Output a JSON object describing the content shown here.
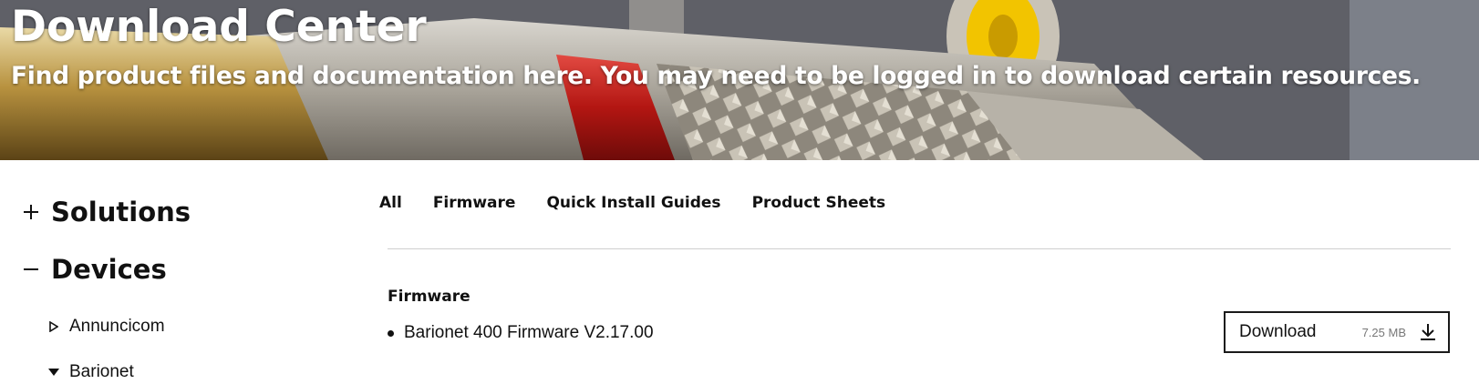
{
  "hero": {
    "title": "Download Center",
    "subtitle": "Find product files and documentation here. You may need to be logged in to download certain resources."
  },
  "sidebar": {
    "categories": [
      {
        "label": "Solutions",
        "state": "collapsed",
        "icon": "plus-icon"
      },
      {
        "label": "Devices",
        "state": "expanded",
        "icon": "minus-icon"
      }
    ],
    "devices": [
      {
        "label": "Annuncicom",
        "state": "collapsed",
        "icon": "triangle-right-outline-icon"
      },
      {
        "label": "Barionet",
        "state": "expanded",
        "icon": "triangle-down-filled-icon"
      }
    ]
  },
  "tabs": [
    {
      "label": "All"
    },
    {
      "label": "Firmware"
    },
    {
      "label": "Quick Install Guides"
    },
    {
      "label": "Product Sheets"
    }
  ],
  "content": {
    "section_title": "Firmware",
    "files": [
      {
        "name": "Barionet 400 Firmware V2.17.00",
        "button_label": "Download",
        "size": "7.25 MB",
        "icon": "download-icon"
      }
    ]
  },
  "colors": {
    "hero_text": "#ffffff",
    "text": "#111111",
    "divider": "#cfcfcf",
    "muted": "#777777"
  }
}
